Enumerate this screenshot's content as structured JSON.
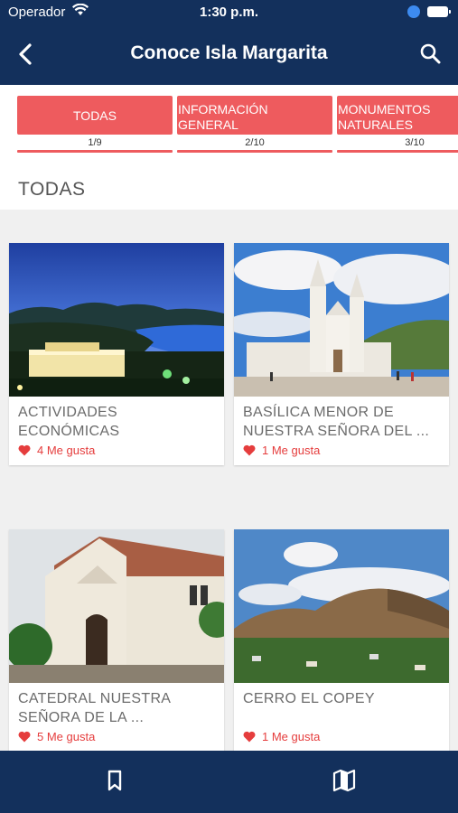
{
  "status_bar": {
    "carrier": "Operador",
    "time": "1:30 p.m."
  },
  "header": {
    "title": "Conoce Isla Margarita"
  },
  "icons": {
    "back": "chevron-left-icon",
    "search": "search-icon",
    "bookmark": "bookmark-icon",
    "map": "map-icon",
    "heart": "heart-icon"
  },
  "colors": {
    "nav": "#13305c",
    "accent": "#ee5b5e",
    "like": "#e53d3d"
  },
  "tabs": [
    {
      "line1": "TODAS",
      "line2": "",
      "count": "1/9"
    },
    {
      "line1": "INFORMACIÓN",
      "line2": "GENERAL",
      "count": "2/10"
    },
    {
      "line1": "MONUMENTOS",
      "line2": "NATURALES",
      "count": "3/10"
    }
  ],
  "section": {
    "title": "TODAS"
  },
  "cards": [
    {
      "line1": "ACTIVIDADES",
      "line2": "ECONÓMICAS",
      "likes": "4 Me gusta"
    },
    {
      "line1": "BASÍLICA MENOR DE",
      "line2": "NUESTRA SEÑORA DEL ...",
      "likes": "1 Me gusta"
    },
    {
      "line1": "CATEDRAL NUESTRA",
      "line2": "SEÑORA DE LA ...",
      "likes": "5 Me gusta"
    },
    {
      "line1": "CERRO EL COPEY",
      "line2": "",
      "likes": "1 Me gusta"
    }
  ]
}
